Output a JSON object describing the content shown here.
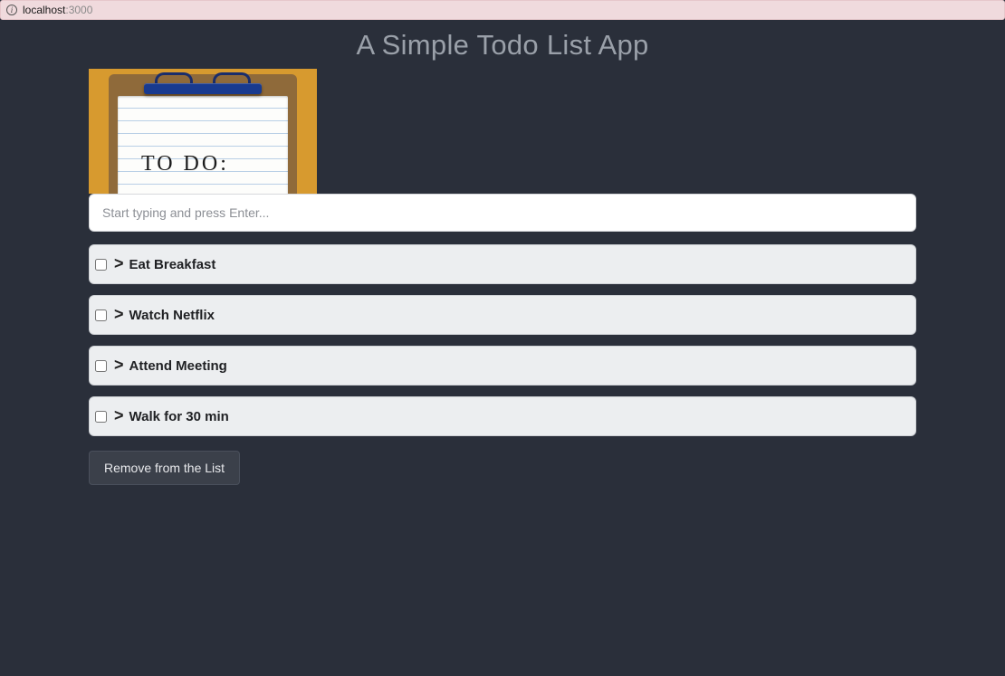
{
  "browser": {
    "host": "localhost",
    "port": ":3000"
  },
  "page": {
    "title": "A Simple Todo List App",
    "hero_handwritten": "TO DO:"
  },
  "input": {
    "placeholder": "Start typing and press Enter...",
    "value": ""
  },
  "todos": [
    {
      "label": "Eat Breakfast",
      "checked": false
    },
    {
      "label": "Watch Netflix",
      "checked": false
    },
    {
      "label": "Attend Meeting",
      "checked": false
    },
    {
      "label": "Walk for 30 min",
      "checked": false
    }
  ],
  "item_prefix": ">",
  "buttons": {
    "remove": "Remove from the List"
  },
  "colors": {
    "page_bg": "#2a2f3a",
    "title_fg": "#9aa0a9",
    "item_bg": "#eceef0",
    "accent_envelope": "#d79a2f",
    "clip_blue": "#183a8f"
  }
}
